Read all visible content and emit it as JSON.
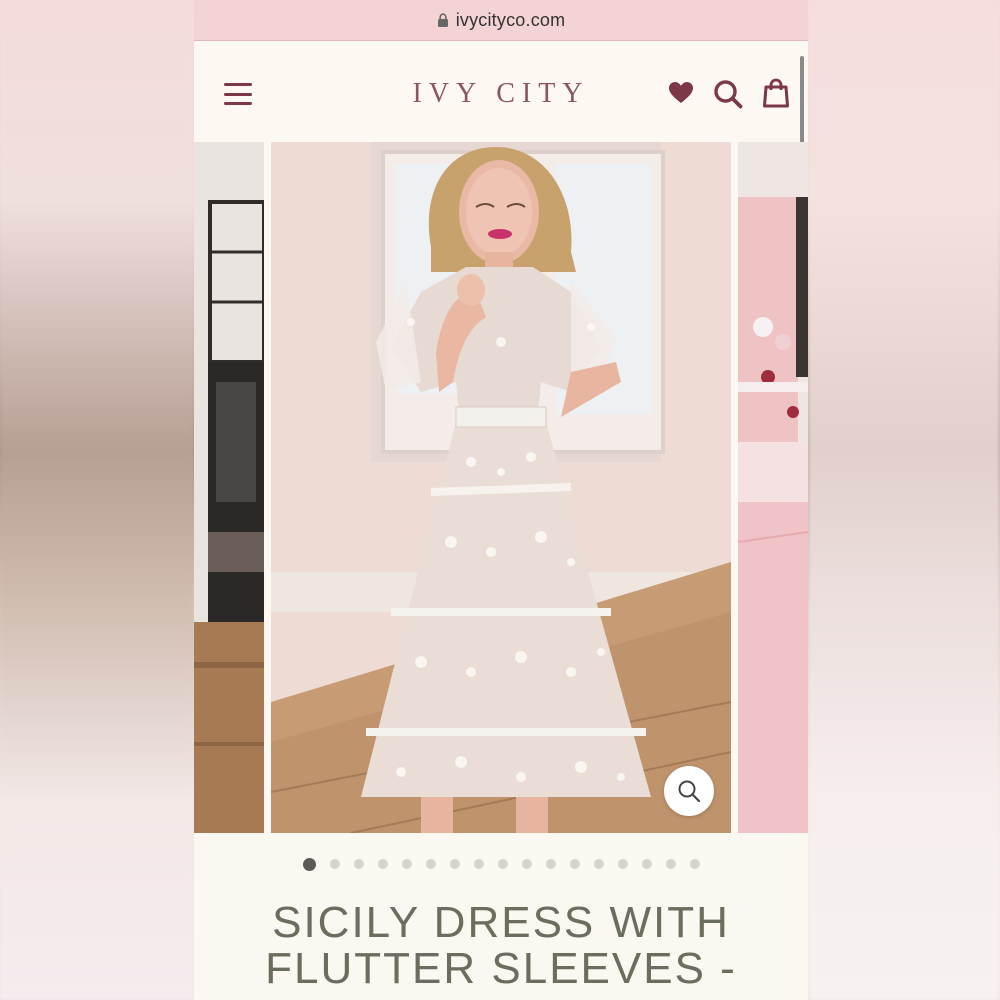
{
  "browser": {
    "url": "ivycityco.com",
    "lock_icon": "lock-icon"
  },
  "header": {
    "logo": "IVY CITY",
    "icons": [
      "menu-icon",
      "heart-icon",
      "search-icon",
      "shopping-bag-icon"
    ],
    "accent_color": "#7d3848"
  },
  "gallery": {
    "slide_count": 17,
    "active_index": 0,
    "zoom_icon": "zoom-icon"
  },
  "product": {
    "title_line1": "SICILY DRESS WITH",
    "title_line2": "FLUTTER SLEEVES -",
    "title_color": "#6b6e5c"
  }
}
